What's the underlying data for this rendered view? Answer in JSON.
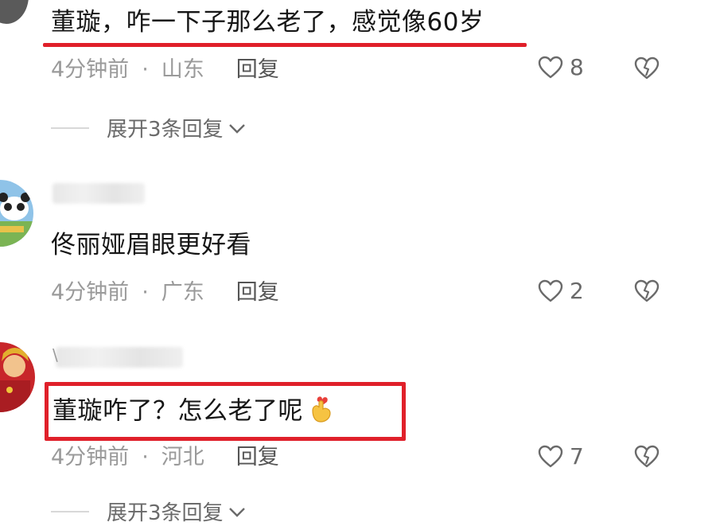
{
  "comments": [
    {
      "text": "董璇，咋一下子那么老了，感觉像60岁",
      "time": "4分钟前",
      "location": "山东",
      "reply_label": "回复",
      "likes": "8",
      "expand_label": "展开3条回复"
    },
    {
      "text": "佟丽娅眉眼更好看",
      "time": "4分钟前",
      "location": "广东",
      "reply_label": "回复",
      "likes": "2"
    },
    {
      "text": "董璇咋了？怎么老了呢",
      "time": "4分钟前",
      "location": "河北",
      "reply_label": "回复",
      "likes": "7",
      "expand_label": "展开3条回复"
    }
  ],
  "colors": {
    "highlight": "#e0202a",
    "meta_text": "#9a9a9a",
    "icon": "#6a6a6a"
  },
  "icons": {
    "like": "heart-outline-icon",
    "dislike": "broken-heart-icon",
    "expand": "chevron-down-icon",
    "emoji": "finger-heart-emoji"
  }
}
